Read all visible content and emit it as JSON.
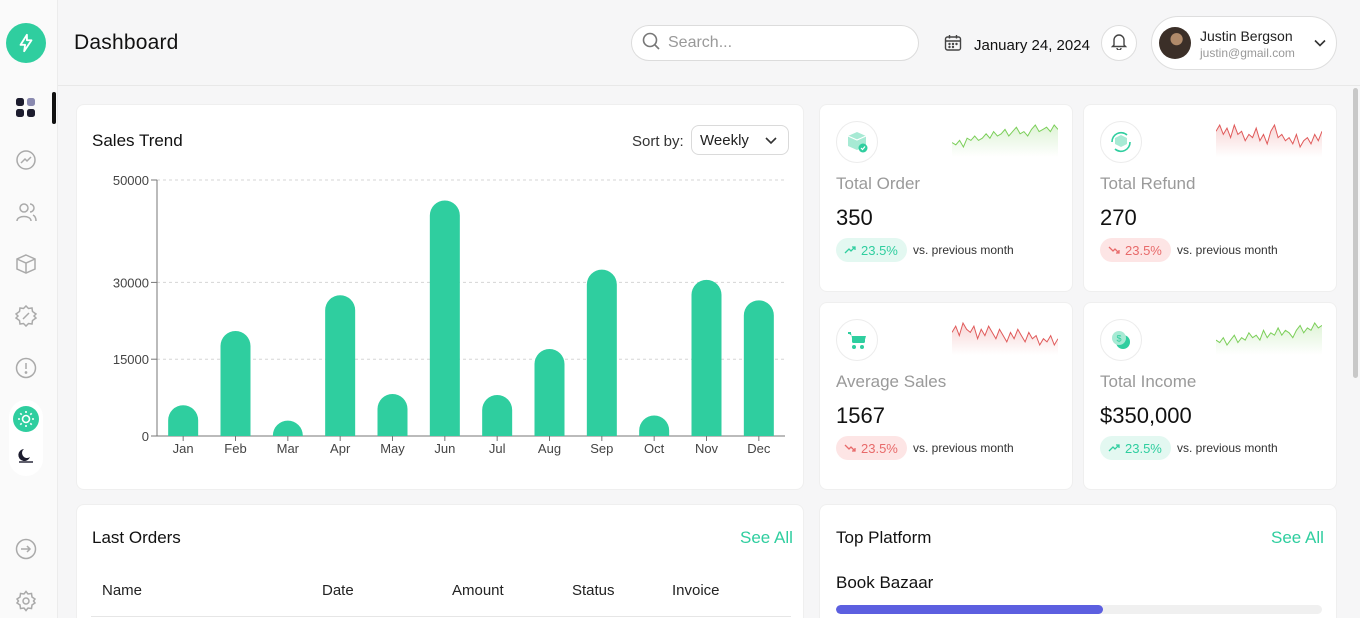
{
  "header": {
    "title": "Dashboard",
    "search_placeholder": "Search...",
    "date": "January 24, 2024",
    "user_name": "Justin Bergson",
    "user_email": "justin@gmail.com"
  },
  "sidebar": {
    "items": [
      "dashboard-icon",
      "analytics-icon",
      "users-icon",
      "box-icon",
      "discount-icon",
      "alert-icon"
    ],
    "bottom": [
      "logout-icon",
      "settings-icon"
    ],
    "theme": [
      "sun-icon",
      "moon-icon"
    ]
  },
  "sales_trend": {
    "title": "Sales Trend",
    "sort_label": "Sort by:",
    "sort_value": "Weekly"
  },
  "chart_data": {
    "type": "bar",
    "categories": [
      "Jan",
      "Feb",
      "Mar",
      "Apr",
      "May",
      "Jun",
      "Jul",
      "Aug",
      "Sep",
      "Oct",
      "Nov",
      "Dec"
    ],
    "values": [
      6000,
      20500,
      3000,
      27500,
      8200,
      46000,
      8000,
      17000,
      32500,
      4000,
      30500,
      26500
    ],
    "ylim": [
      0,
      50000
    ],
    "yticks": [
      0,
      15000,
      30000,
      50000
    ],
    "grid": true,
    "color": "#2fce9f"
  },
  "stats": [
    {
      "label": "Total Order",
      "value": "350",
      "change": "23.5%",
      "trend": "up",
      "icon": "box-check-icon",
      "spark": "green",
      "spark_values": [
        4,
        3,
        5,
        2,
        6,
        5,
        7,
        5,
        6,
        8,
        6,
        9,
        7,
        8,
        10,
        7,
        9,
        11,
        8,
        9,
        7,
        10,
        12,
        9,
        10,
        11,
        9,
        12,
        10
      ]
    },
    {
      "label": "Total Refund",
      "value": "270",
      "change": "23.5%",
      "trend": "down",
      "icon": "refund-icon",
      "spark": "red",
      "spark_values": [
        10,
        12,
        9,
        11,
        8,
        12,
        9,
        10,
        7,
        9,
        8,
        11,
        7,
        9,
        6,
        10,
        12,
        8,
        9,
        7,
        8,
        6,
        9,
        5,
        7,
        8,
        6,
        9,
        7,
        10
      ]
    },
    {
      "label": "Average Sales",
      "value": "1567",
      "change": "23.5%",
      "trend": "down",
      "icon": "cart-icon",
      "spark": "red",
      "spark_values": [
        9,
        11,
        8,
        12,
        10,
        9,
        11,
        7,
        10,
        8,
        11,
        9,
        7,
        10,
        8,
        6,
        9,
        7,
        10,
        8,
        6,
        9,
        7,
        8,
        5,
        7,
        6,
        8,
        5,
        7
      ]
    },
    {
      "label": "Total Income",
      "value": "$350,000",
      "change": "23.5%",
      "trend": "up",
      "icon": "coin-icon",
      "spark": "green",
      "spark_values": [
        5,
        4,
        6,
        3,
        5,
        7,
        4,
        6,
        5,
        8,
        6,
        7,
        5,
        9,
        6,
        8,
        7,
        10,
        7,
        9,
        8,
        6,
        9,
        11,
        8,
        10,
        9,
        12,
        10,
        11
      ]
    }
  ],
  "stat_vs": "vs. previous month",
  "orders": {
    "title": "Last Orders",
    "see_all": "See All",
    "columns": [
      "Name",
      "Date",
      "Amount",
      "Status",
      "Invoice"
    ]
  },
  "platform": {
    "title": "Top Platform",
    "see_all": "See All",
    "items": [
      {
        "name": "Book Bazaar",
        "progress": 0.55
      }
    ]
  },
  "colors": {
    "accent": "#2fce9f",
    "down": "#e86a6a",
    "bar": "#5c5fe0"
  }
}
